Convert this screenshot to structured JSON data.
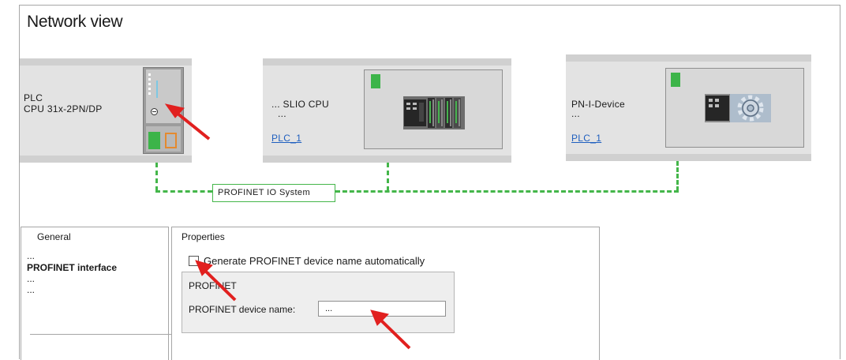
{
  "header": {
    "title": "Network view"
  },
  "devices": {
    "plc": {
      "name": "PLC",
      "type": "CPU 31x-2PN/DP"
    },
    "slio": {
      "name": "... SLIO CPU",
      "detail": "...",
      "link": "PLC_1"
    },
    "pnidevice": {
      "name": "PN-I-Device",
      "detail": "...",
      "link": "PLC_1"
    }
  },
  "network": {
    "label": "PROFINET IO System"
  },
  "inspector": {
    "nav": {
      "header": "General",
      "items": [
        "...",
        "PROFINET interface",
        "...",
        "..."
      ],
      "selected_index": 1
    },
    "properties": {
      "header": "Properties",
      "checkbox_label": "Generate PROFINET device name automatically",
      "checkbox_checked": false,
      "group_title": "PROFINET",
      "field_label": "PROFINET device name:",
      "field_value": "..."
    }
  },
  "colors": {
    "status_green": "#3cb449",
    "profinet_line": "#44b64a",
    "highlight_arrow": "#e1201f",
    "link": "#1f5fbf"
  }
}
